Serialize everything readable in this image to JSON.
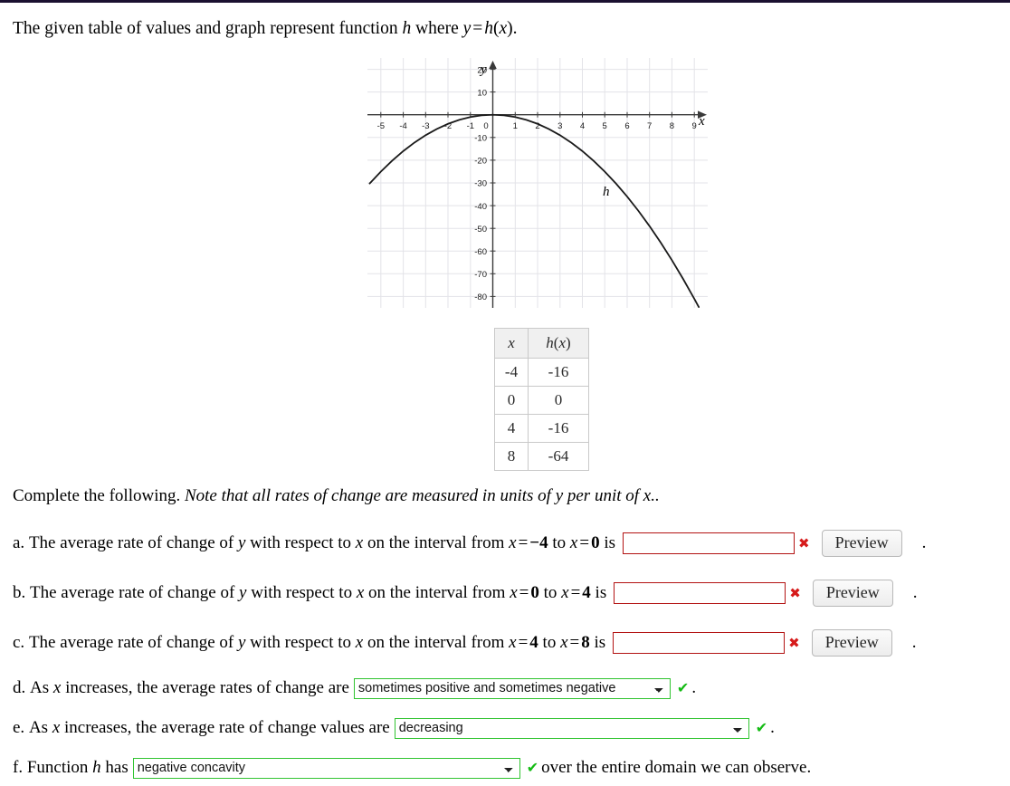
{
  "prompt": {
    "part1": "The given table of values and graph represent function ",
    "fn": "h",
    "part2": " where ",
    "eq_y": "y",
    "eq_op": "=",
    "eq_h": "h",
    "eq_paren_open": "(",
    "eq_x": "x",
    "eq_paren_close": ")",
    "period": "."
  },
  "graph": {
    "y_axis_label": "y",
    "x_axis_label": "x",
    "curve_label": "h",
    "x_ticks": [
      "-5",
      "-4",
      "-3",
      "-2",
      "-1",
      "0",
      "1",
      "2",
      "3",
      "4",
      "5",
      "6",
      "7",
      "8",
      "9"
    ],
    "y_ticks": [
      "20",
      "10",
      "-10",
      "-20",
      "-30",
      "-40",
      "-50",
      "-60",
      "-70",
      "-80"
    ],
    "grid_color": "#e3e3e8",
    "axis_color": "#3a3a3a",
    "curve_color": "#1a1a1a"
  },
  "chart_data": {
    "type": "line",
    "title": "",
    "xlabel": "x",
    "ylabel": "y",
    "curve_label": "h",
    "function": "h(x) = -x^2",
    "xlim": [
      -5.6,
      9.6
    ],
    "ylim": [
      -85,
      25
    ],
    "xticks": [
      -5,
      -4,
      -3,
      -2,
      -1,
      0,
      1,
      2,
      3,
      4,
      5,
      6,
      7,
      8,
      9
    ],
    "yticks": [
      20,
      10,
      -10,
      -20,
      -30,
      -40,
      -50,
      -60,
      -70,
      -80
    ],
    "grid": true,
    "legend": "none",
    "x": [
      -5.5,
      -5,
      -4.5,
      -4,
      -3.5,
      -3,
      -2.5,
      -2,
      -1.5,
      -1,
      -0.5,
      0,
      0.5,
      1,
      1.5,
      2,
      2.5,
      3,
      3.5,
      4,
      4.5,
      5,
      5.5,
      6,
      6.5,
      7,
      7.5,
      8,
      8.5,
      9,
      9.2
    ],
    "y": [
      -30.25,
      -25,
      -20.25,
      -16,
      -12.25,
      -9,
      -6.25,
      -4,
      -2.25,
      -1,
      -0.25,
      0,
      -0.25,
      -1,
      -2.25,
      -4,
      -6.25,
      -9,
      -12.25,
      -16,
      -20.25,
      -25,
      -30.25,
      -36,
      -42.25,
      -49,
      -56.25,
      -64,
      -72.25,
      -81,
      -84.64
    ]
  },
  "table": {
    "headers": [
      "x",
      "h(x)"
    ],
    "header_x": "x",
    "header_h_fn": "h",
    "header_h_open": "(",
    "header_h_var": "x",
    "header_h_close": ")",
    "rows": [
      {
        "x": "-4",
        "h": "-16"
      },
      {
        "x": "0",
        "h": "0"
      },
      {
        "x": "4",
        "h": "-16"
      },
      {
        "x": "8",
        "h": "-64"
      }
    ]
  },
  "complete": {
    "lead": "Complete the following. ",
    "note": "Note that all rates of change are measured in units of ",
    "note_y": "y",
    "note_mid": " per unit of ",
    "note_x": "x",
    "note_end": ".."
  },
  "questions": {
    "a": {
      "label": "a.",
      "text1": "The average rate of change of ",
      "var_y": "y",
      "text2": " with respect to ",
      "var_x": "x",
      "text3": " on the interval from ",
      "from_var": "x",
      "from_eq": "=",
      "from_val": "−4",
      "to_word": " to ",
      "to_var": "x",
      "to_eq": "=",
      "to_val": "0",
      "text4": " is",
      "input_value": "",
      "input_placeholder": "",
      "mark": "✖",
      "mark_status": "incorrect",
      "preview_label": "Preview",
      "trailing": "."
    },
    "b": {
      "label": "b.",
      "text1": "The average rate of change of ",
      "var_y": "y",
      "text2": " with respect to ",
      "var_x": "x",
      "text3": " on the interval from ",
      "from_var": "x",
      "from_eq": "=",
      "from_val": "0",
      "to_word": " to ",
      "to_var": "x",
      "to_eq": "=",
      "to_val": "4",
      "text4": " is",
      "input_value": "",
      "input_placeholder": "",
      "mark": "✖",
      "mark_status": "incorrect",
      "preview_label": "Preview",
      "trailing": "."
    },
    "c": {
      "label": "c.",
      "text1": "The average rate of change of ",
      "var_y": "y",
      "text2": " with respect to ",
      "var_x": "x",
      "text3": " on the interval from ",
      "from_var": "x",
      "from_eq": "=",
      "from_val": "4",
      "to_word": " to ",
      "to_var": "x",
      "to_eq": "=",
      "to_val": "8",
      "text4": " is",
      "input_value": "",
      "input_placeholder": "",
      "mark": "✖",
      "mark_status": "incorrect",
      "preview_label": "Preview",
      "trailing": "."
    },
    "d": {
      "label": "d.",
      "text1": "As ",
      "var_x": "x",
      "text2": " increases, the average rates of change are",
      "selected": "sometimes positive and sometimes negative",
      "options": [
        "sometimes positive and sometimes negative"
      ],
      "mark": "✔",
      "mark_status": "correct",
      "trailing": "."
    },
    "e": {
      "label": "e.",
      "text1": "As ",
      "var_x": "x",
      "text2": " increases, the average rate of change values are",
      "selected": "decreasing",
      "options": [
        "decreasing"
      ],
      "mark": "✔",
      "mark_status": "correct",
      "trailing": "."
    },
    "f": {
      "label": "f.",
      "text1": "Function ",
      "var_h": "h",
      "text2": " has",
      "selected": "negative concavity",
      "options": [
        "negative concavity"
      ],
      "mark": "✔",
      "mark_status": "correct",
      "trailing": "over the entire domain we can observe."
    }
  },
  "colors": {
    "error_red": "#b31313",
    "mark_red": "#d61b1b",
    "ok_green": "#14bb14",
    "select_border_green": "#31c431",
    "top_rule": "#1a1030"
  }
}
